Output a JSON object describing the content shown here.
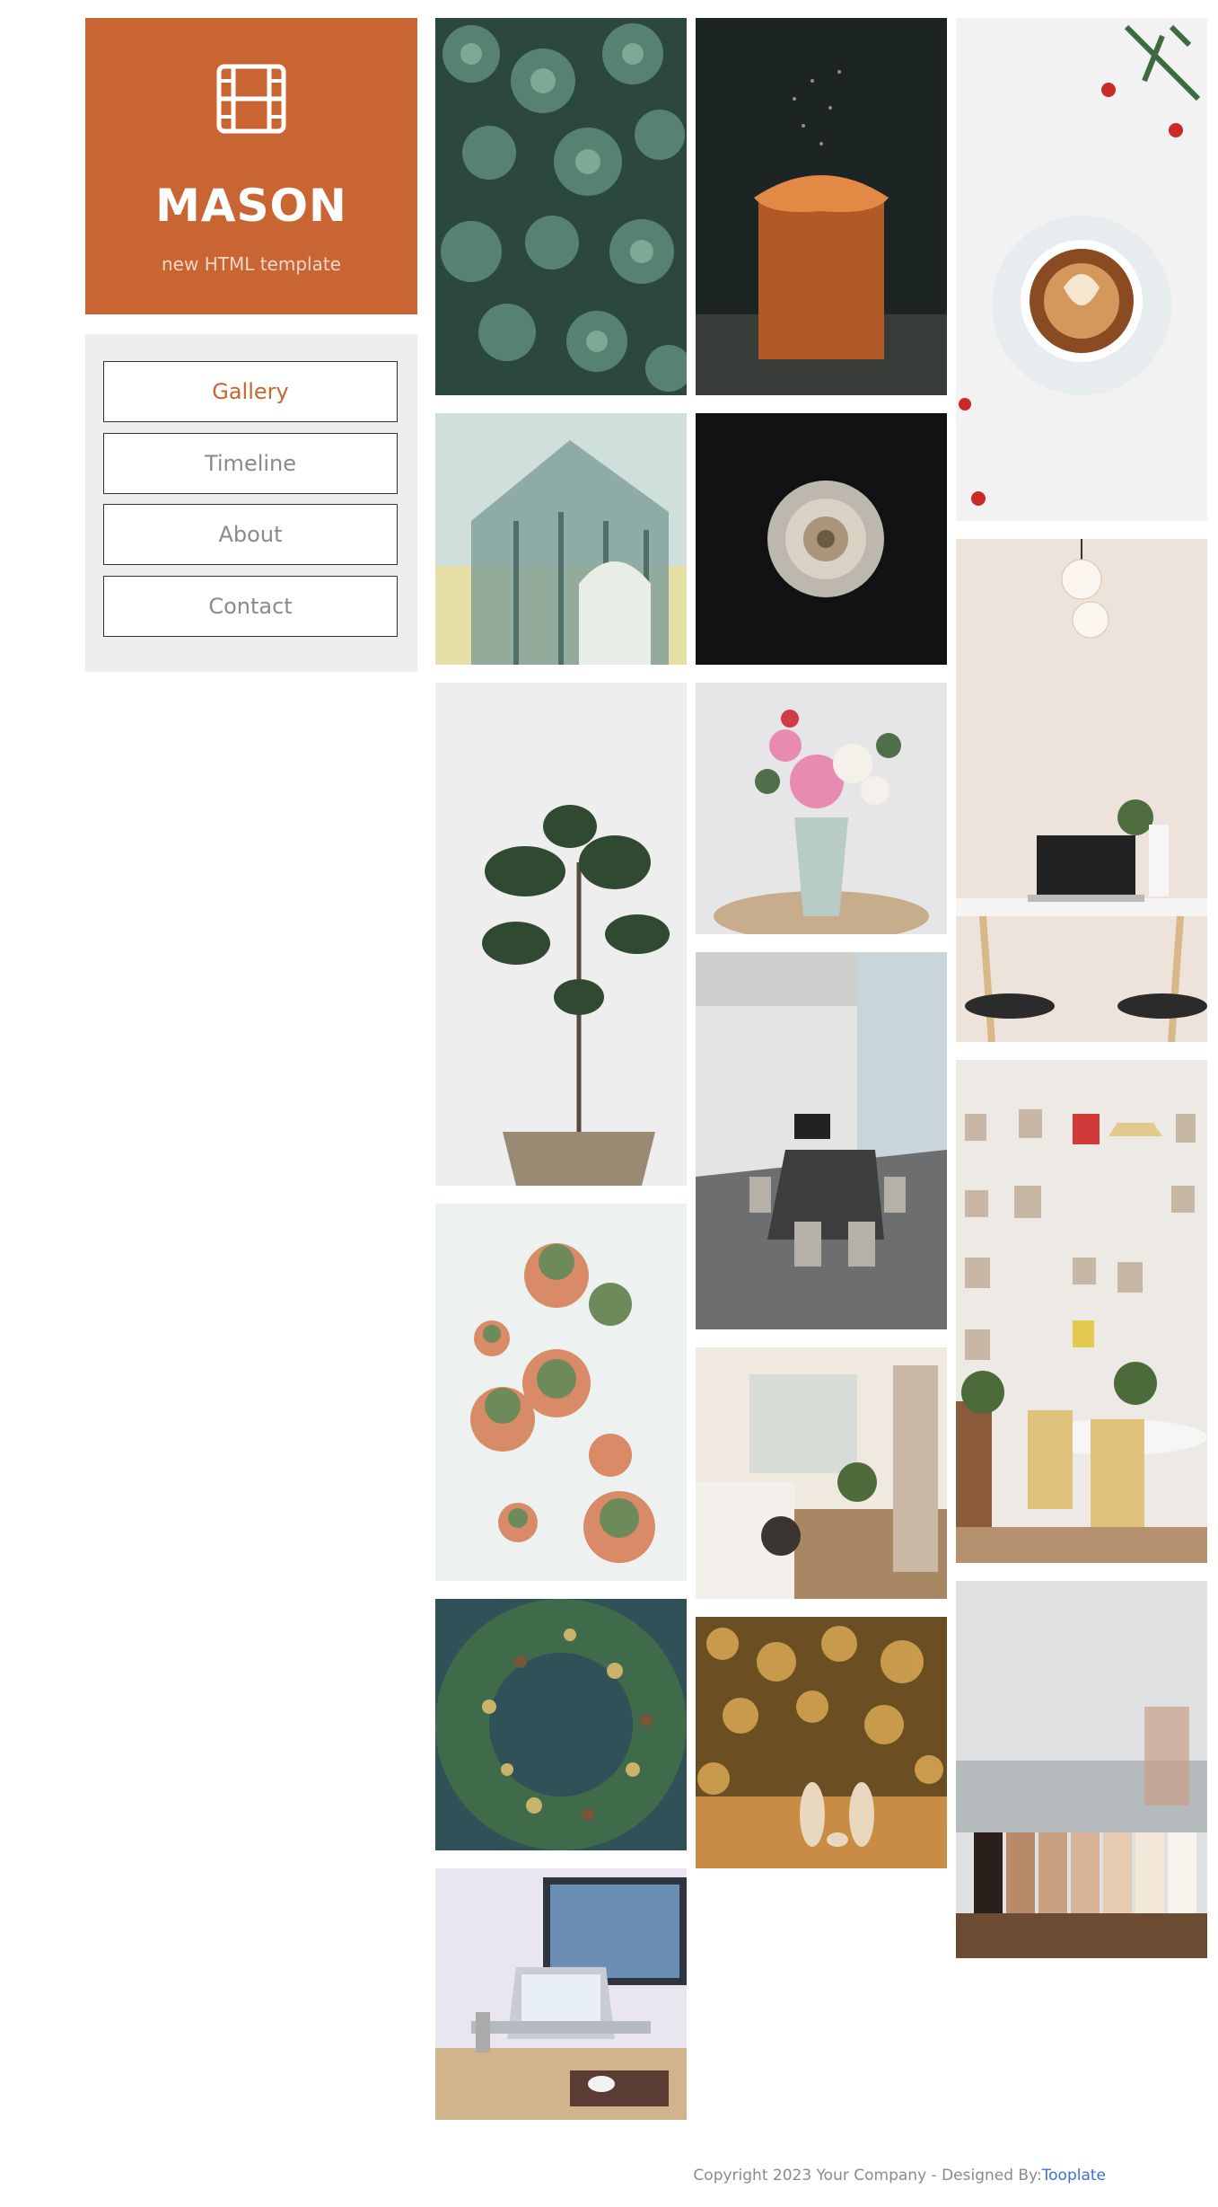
{
  "brand": {
    "icon": "film-icon",
    "title": "MASON",
    "subtitle": "new HTML template",
    "color": "#c96533"
  },
  "nav": {
    "items": [
      {
        "label": "Gallery",
        "active": true
      },
      {
        "label": "Timeline",
        "active": false
      },
      {
        "label": "About",
        "active": false
      },
      {
        "label": "Contact",
        "active": false
      }
    ]
  },
  "gallery": {
    "images": [
      "succulents-photo",
      "cake-photo",
      "coffee-cup-photo",
      "banknote-detail-photo",
      "white-rose-photo",
      "fiddle-leaf-plant-photo",
      "flower-bouquet-photo",
      "desk-laptop-photo",
      "conference-room-photo",
      "potted-cacti-photo",
      "wall-photos-dining-photo",
      "bedroom-interior-photo",
      "christmas-wreath-photo",
      "bokeh-figurines-photo",
      "coffee-jars-photo",
      "workspace-laptop-monitor-photo"
    ]
  },
  "footer": {
    "copyright": "Copyright 2023 Your Company - Designed By:",
    "link_label": "Tooplate"
  }
}
